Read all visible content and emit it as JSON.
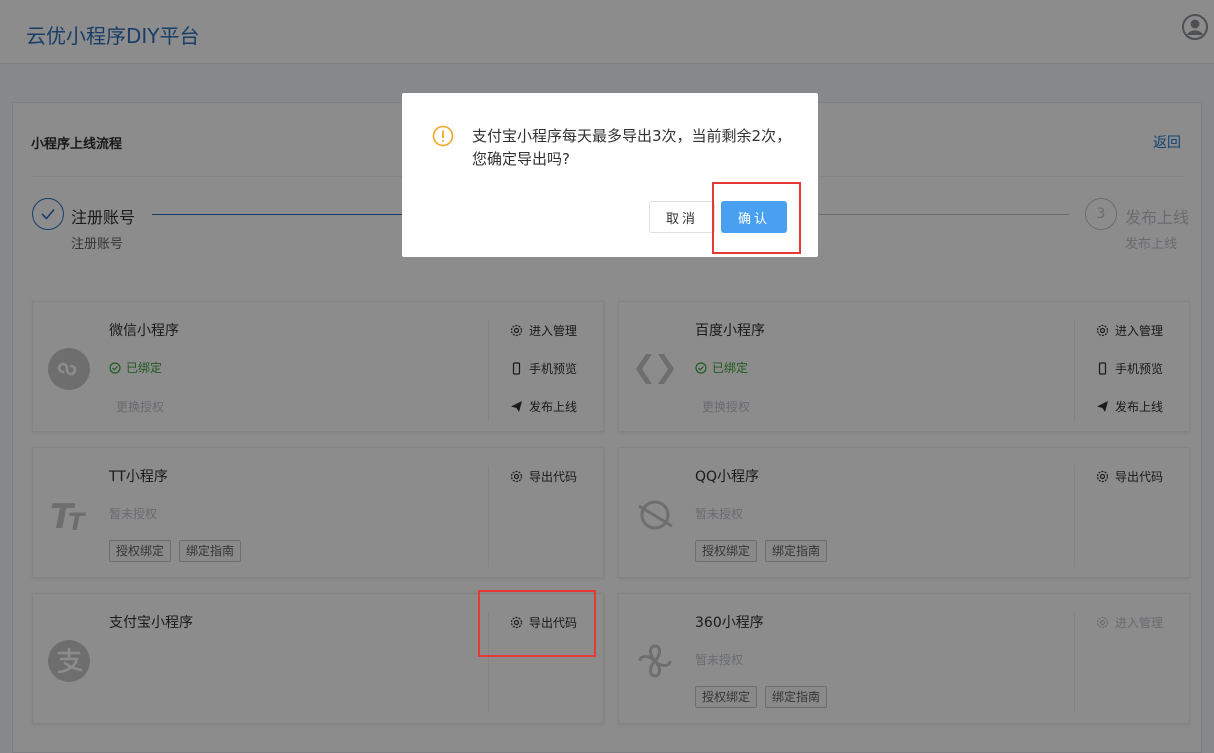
{
  "app": {
    "title": "云优小程序DIY平台",
    "user_icon": "user-avatar-icon"
  },
  "panel": {
    "title": "小程序上线流程",
    "back_label": "返回"
  },
  "steps": [
    {
      "title": "注册账号",
      "desc": "注册账号",
      "status": "done"
    },
    {
      "number": "3",
      "title": "发布上线",
      "desc": "发布上线",
      "status": "pending"
    }
  ],
  "cards": [
    {
      "name": "微信小程序",
      "logo": "wechat-miniprogram-logo",
      "status": "已绑定",
      "reauth": "更换授权",
      "actions": [
        "进入管理",
        "手机预览",
        "发布上线"
      ]
    },
    {
      "name": "百度小程序",
      "logo": "baidu-miniprogram-logo",
      "status": "已绑定",
      "reauth": "更换授权",
      "actions": [
        "进入管理",
        "手机预览",
        "发布上线"
      ]
    },
    {
      "name": "TT小程序",
      "logo": "toutiao-miniprogram-logo",
      "status": "暂未授权",
      "buttons": [
        "授权绑定",
        "绑定指南"
      ],
      "actions": [
        "导出代码"
      ]
    },
    {
      "name": "QQ小程序",
      "logo": "qq-miniprogram-logo",
      "status": "暂未授权",
      "buttons": [
        "授权绑定",
        "绑定指南"
      ],
      "actions": [
        "导出代码"
      ]
    },
    {
      "name": "支付宝小程序",
      "logo": "alipay-miniprogram-logo",
      "actions": [
        "导出代码"
      ]
    },
    {
      "name": "360小程序",
      "logo": "360-miniprogram-logo",
      "status": "暂未授权",
      "buttons": [
        "授权绑定",
        "绑定指南"
      ],
      "actions": [
        "进入管理"
      ]
    }
  ],
  "dialog": {
    "message": "支付宝小程序每天最多导出3次，当前剩余2次，您确定导出吗?",
    "cancel_label": "取消",
    "confirm_label": "确认",
    "icon": "warning-icon"
  },
  "colors": {
    "brand_blue": "#2f6fbf",
    "confirm_button": "#4aa0f0",
    "bound_green": "#3aa43a",
    "warning_orange": "#f5a623",
    "highlight_red": "#e53935"
  }
}
